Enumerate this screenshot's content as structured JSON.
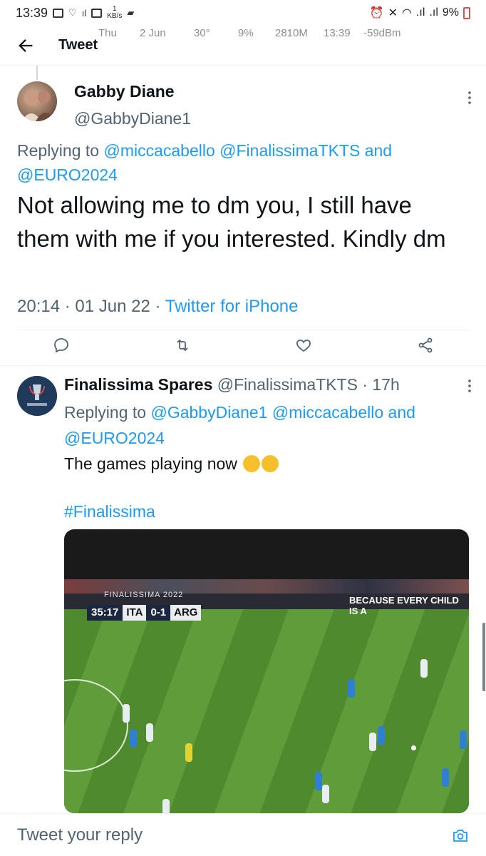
{
  "status_bar": {
    "time": "13:39",
    "net_speed_value": "1",
    "net_speed_unit": "KB/s",
    "battery": "9%"
  },
  "overlay_stats": [
    "Thu",
    "2 Jun",
    "30°",
    "9%",
    "2810M",
    "13:39",
    "-59dBm"
  ],
  "header": {
    "back_icon": "arrow-left-icon",
    "title": "Tweet"
  },
  "main_tweet": {
    "display_name": "Gabby Diane",
    "handle": "@GabbyDiane1",
    "replying_prefix": "Replying to",
    "replying_to_1": "@miccacabello",
    "replying_to_2": "@FinalissimaTKTS",
    "replying_and": "and",
    "replying_to_3": "@EURO2024",
    "text": "Not allowing me to dm you, I still have them with me if you interested. Kindly dm",
    "time": "20:14",
    "dot": "·",
    "date": "01 Jun 22",
    "source": "Twitter for iPhone",
    "actions": [
      "reply-icon",
      "retweet-icon",
      "like-icon",
      "share-icon"
    ]
  },
  "reply_tweet": {
    "display_name": "Finalissima Spares",
    "handle": "@FinalissimaTKTS",
    "dot": "·",
    "age": "17h",
    "replying_prefix": "Replying to",
    "replying_to_1": "@GabbyDiane1",
    "replying_to_2": "@miccacabello",
    "replying_and": "and",
    "replying_to_3": "@EURO2024",
    "text": "The games playing now",
    "hashtag": "#Finalissima",
    "media": {
      "overlay_title": "FINALISSIMA 2022",
      "clock": "35:17",
      "home": "ITA",
      "score": "0-1",
      "away": "ARG",
      "board": "BECAUSE EVERY CHILD IS A"
    }
  },
  "reply_bar": {
    "placeholder": "Tweet your reply",
    "camera_icon": "camera-icon"
  },
  "colors": {
    "accent": "#1d9bf0",
    "secondary_text": "#536471",
    "primary_text": "#0f1419"
  }
}
